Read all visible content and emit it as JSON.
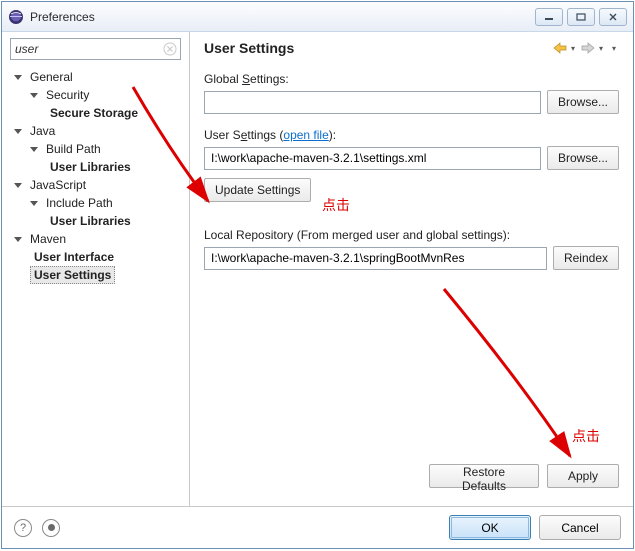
{
  "window": {
    "title": "Preferences"
  },
  "sidebar": {
    "search_value": "user",
    "tree": {
      "general": {
        "label": "General",
        "security": {
          "label": "Security",
          "secure_storage": {
            "label": "Secure Storage"
          }
        }
      },
      "java": {
        "label": "Java",
        "build_path": {
          "label": "Build Path",
          "user_libraries": {
            "label": "User Libraries"
          }
        }
      },
      "javascript": {
        "label": "JavaScript",
        "include_path": {
          "label": "Include Path",
          "user_libraries": {
            "label": "User Libraries"
          }
        }
      },
      "maven": {
        "label": "Maven",
        "user_interface": {
          "label": "User Interface"
        },
        "user_settings": {
          "label": "User Settings"
        }
      }
    }
  },
  "content": {
    "heading": "User Settings",
    "global_label_pre": "Global ",
    "global_label_ul": "S",
    "global_label_post": "ettings:",
    "global_value": "",
    "browse": "Browse...",
    "user_label_pre": "User S",
    "user_label_ul": "e",
    "user_label_post": "ttings (",
    "open_file": "open file",
    "user_label_close": "):",
    "user_value": "I:\\work\\apache-maven-3.2.1\\settings.xml",
    "update_btn": "Update Settings",
    "local_repo_label": "Local Repository (From merged user and global settings):",
    "local_repo_value": "I:\\work\\apache-maven-3.2.1\\springBootMvnRes",
    "reindex": "Reindex",
    "restore_defaults": "Restore Defaults",
    "apply": "Apply"
  },
  "footer": {
    "ok": "OK",
    "cancel": "Cancel"
  },
  "annotations": {
    "click1": "点击",
    "click2": "点击"
  }
}
